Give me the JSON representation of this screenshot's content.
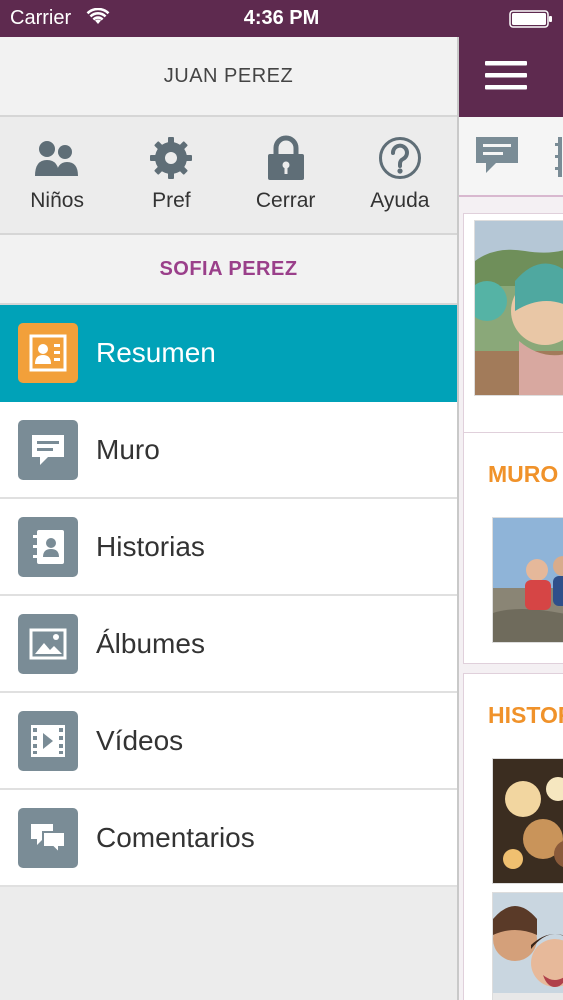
{
  "status_bar": {
    "carrier": "Carrier",
    "time": "4:36 PM",
    "wifi_icon": "wifi-icon",
    "battery_icon": "battery-icon"
  },
  "drawer": {
    "user_name": "JUAN PEREZ",
    "quick_actions": [
      {
        "label": "Niños",
        "icon": "children-icon"
      },
      {
        "label": "Pref",
        "icon": "gear-icon"
      },
      {
        "label": "Cerrar",
        "icon": "lock-icon"
      },
      {
        "label": "Ayuda",
        "icon": "help-icon"
      }
    ],
    "child_name": "SOFIA PEREZ",
    "menu": [
      {
        "label": "Resumen",
        "icon": "summary-icon",
        "active": true
      },
      {
        "label": "Muro",
        "icon": "wall-icon",
        "active": false
      },
      {
        "label": "Historias",
        "icon": "stories-icon",
        "active": false
      },
      {
        "label": "Álbumes",
        "icon": "albums-icon",
        "active": false
      },
      {
        "label": "Vídeos",
        "icon": "videos-icon",
        "active": false
      },
      {
        "label": "Comentarios",
        "icon": "comments-icon",
        "active": false
      }
    ]
  },
  "content": {
    "menu_icon": "hamburger-icon",
    "sections": [
      {
        "title": "MURO"
      },
      {
        "title": "HISTOR"
      }
    ]
  },
  "colors": {
    "brand_purple": "#5e2a4f",
    "accent_teal": "#00a2b8",
    "accent_orange": "#f0922a",
    "child_name": "#9a3f8a",
    "icon_gray": "#7a8c96"
  }
}
